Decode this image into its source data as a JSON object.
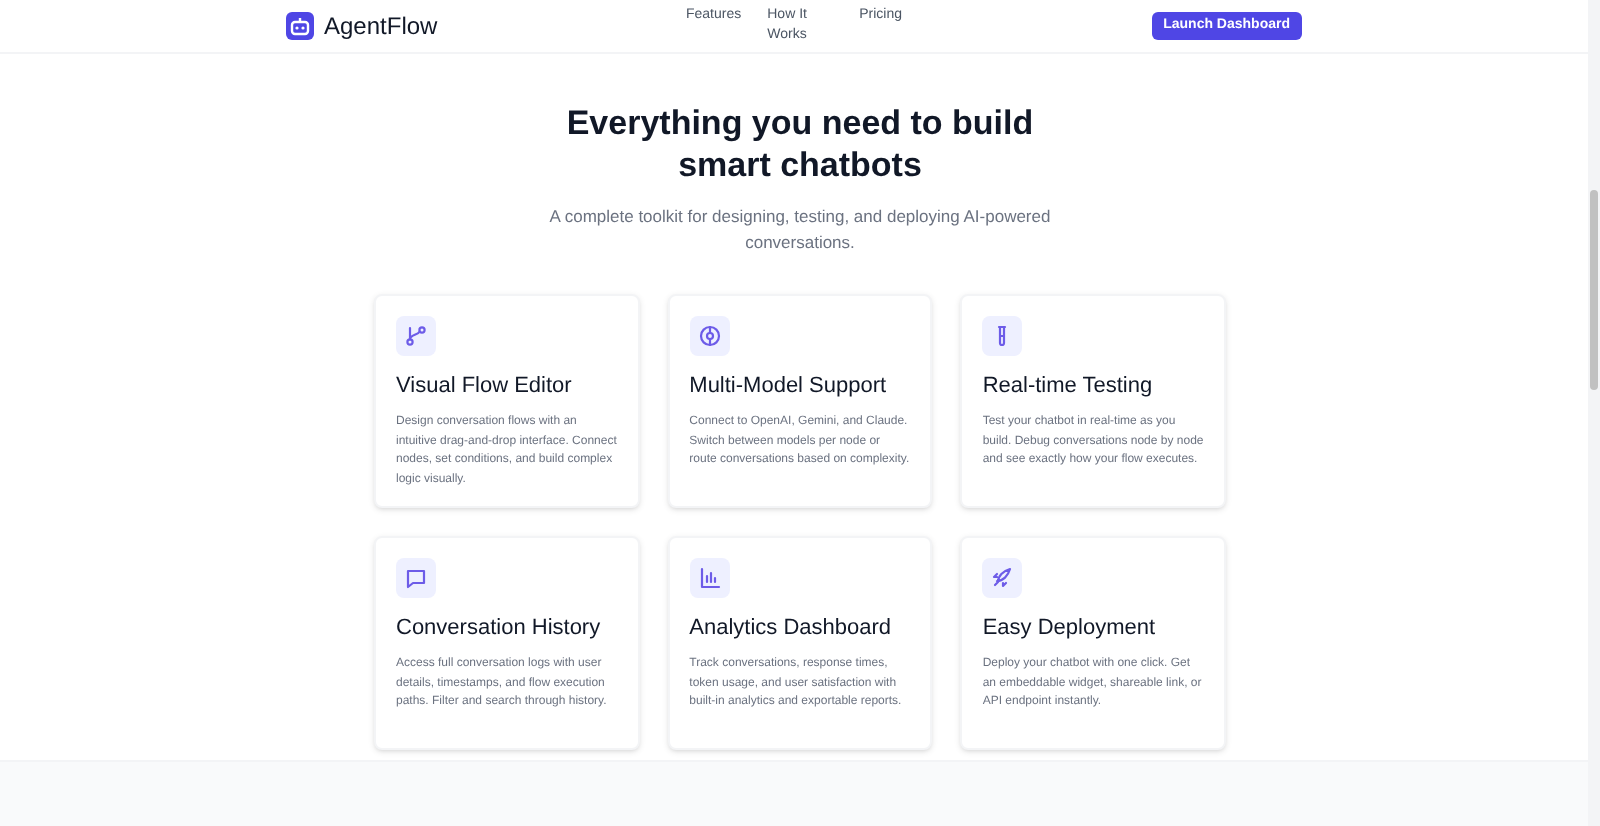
{
  "header": {
    "brand": "AgentFlow",
    "nav": [
      "Features",
      "How It Works",
      "Pricing"
    ],
    "cta": "Launch Dashboard"
  },
  "hero": {
    "title": "Everything you need to build smart chatbots",
    "subtitle": "A complete toolkit for designing, testing, and deploying AI-powered conversations."
  },
  "features": [
    {
      "kind": "branch",
      "title": "Visual Flow Editor",
      "description": "Design conversation flows with an intuitive drag-and-drop interface. Connect nodes, set conditions, and build complex logic visually."
    },
    {
      "kind": "chip",
      "title": "Multi-Model Support",
      "description": "Connect to OpenAI, Gemini, and Claude. Switch between models per node or route conversations based on complexity."
    },
    {
      "kind": "tube",
      "title": "Real-time Testing",
      "description": "Test your chatbot in real-time as you build. Debug conversations node by node and see exactly how your flow executes."
    },
    {
      "kind": "message",
      "title": "Conversation History",
      "description": "Access full conversation logs with user details, timestamps, and flow execution paths. Filter and search through history."
    },
    {
      "kind": "chart",
      "title": "Analytics Dashboard",
      "description": "Track conversations, response times, token usage, and user satisfaction with built-in analytics and exportable reports."
    },
    {
      "kind": "rocket",
      "title": "Easy Deployment",
      "description": "Deploy your chatbot with one click. Get an embeddable widget, shareable link, or API endpoint instantly."
    }
  ]
}
